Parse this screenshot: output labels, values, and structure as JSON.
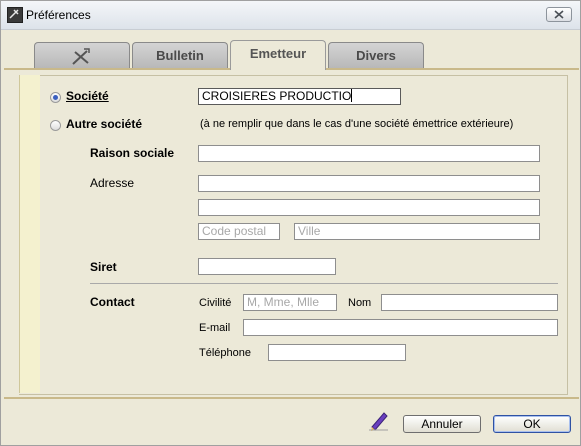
{
  "window": {
    "title": "Préférences"
  },
  "tabs": [
    {
      "label": "",
      "icon": "tools-icon"
    },
    {
      "label": "Bulletin"
    },
    {
      "label": "Emetteur",
      "active": true
    },
    {
      "label": "Divers"
    }
  ],
  "issuer": {
    "company_radio": "Société",
    "company_value": "CROISIERES PRODUCTIO",
    "other_company_radio": "Autre société",
    "other_company_note": "(à ne remplir que dans le cas d'une société émettrice extérieure)",
    "selected": "company"
  },
  "form": {
    "raison_sociale_label": "Raison sociale",
    "raison_sociale_value": "",
    "adresse_label": "Adresse",
    "adresse_line1": "",
    "adresse_line2": "",
    "code_postal_placeholder": "Code postal",
    "ville_placeholder": "Ville",
    "siret_label": "Siret",
    "siret_value": ""
  },
  "contact": {
    "section_label": "Contact",
    "civilite_label": "Civilité",
    "civilite_placeholder": "M, Mme, Mlle",
    "nom_label": "Nom",
    "nom_value": "",
    "email_label": "E-mail",
    "email_value": "",
    "telephone_label": "Téléphone",
    "telephone_value": ""
  },
  "buttons": {
    "cancel": "Annuler",
    "ok": "OK"
  },
  "colors": {
    "accent_radio": "#3a5fbf",
    "strip": "#f4f1cf",
    "separator": "#c9b98a"
  }
}
